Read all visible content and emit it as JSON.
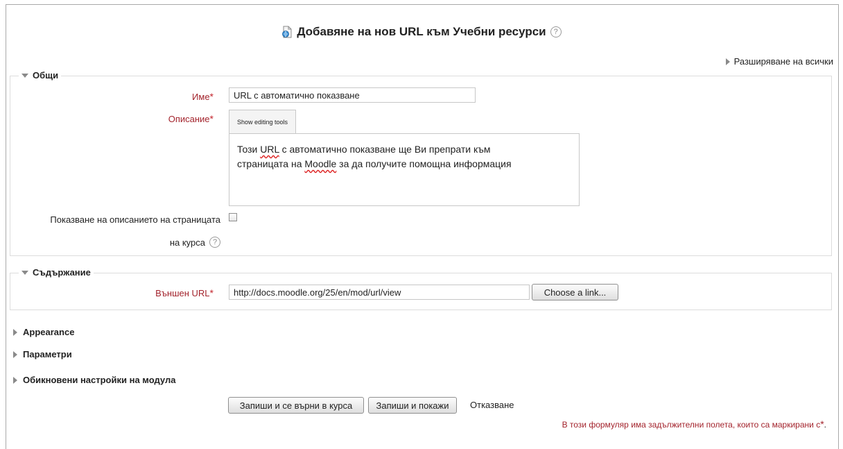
{
  "page": {
    "title": "Добавяне на нов URL към Учебни ресурси",
    "expand_all": "Разширяване на всички"
  },
  "general": {
    "legend": "Общи",
    "name_label": "Име",
    "name_value": "URL с автоматично показване",
    "description_label": "Описание",
    "show_editing_tools": "Show editing tools",
    "description_text": {
      "part1": "Този ",
      "word1": "URL",
      "part2": " с автоматично показване ще Ви препрати към",
      "part3": "страницата на ",
      "word2": "Moodle",
      "part4": " за да получите помощна информация"
    },
    "show_description_label_line1": "Показване на описанието на страницата",
    "show_description_label_line2": "на курса",
    "show_description_checked": false
  },
  "content": {
    "legend": "Съдържание",
    "external_url_label": "Външен URL",
    "external_url_value": "http://docs.moodle.org/25/en/mod/url/view",
    "choose_link_button": "Choose a link..."
  },
  "collapsed_sections": {
    "appearance": "Appearance",
    "parameters": "Параметри",
    "common_module_settings": "Обикновени настройки на модула"
  },
  "actions": {
    "save_return": "Запиши и се върни в курса",
    "save_display": "Запиши и покажи",
    "cancel": "Отказване",
    "required_note": "В този формуляр има задължителни полета, които са маркирани с",
    "required_star": "*",
    "required_period": "."
  },
  "icons": {
    "page_icon": "document-icon",
    "help_icon": "help-icon",
    "expand_icon": "triangle-right-icon",
    "collapse_icon": "triangle-down-icon"
  }
}
